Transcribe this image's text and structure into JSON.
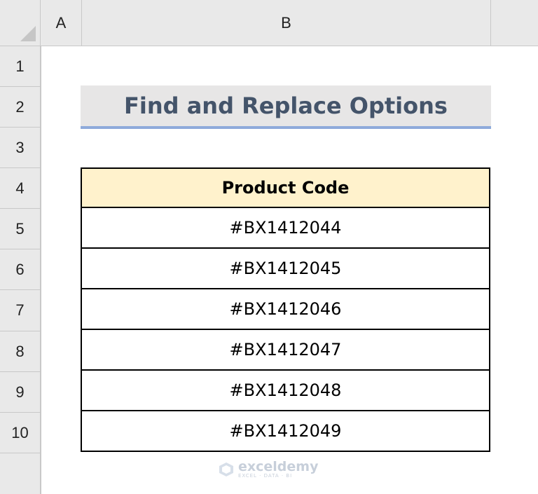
{
  "columns": [
    "A",
    "B"
  ],
  "rows": [
    "1",
    "2",
    "3",
    "4",
    "5",
    "6",
    "7",
    "8",
    "9",
    "10"
  ],
  "title": "Find and Replace Options",
  "table": {
    "header": "Product Code",
    "codes": [
      "#BX1412044",
      "#BX1412045",
      "#BX1412046",
      "#BX1412047",
      "#BX1412048",
      "#BX1412049"
    ]
  },
  "watermark": {
    "name": "exceldemy",
    "tagline": "EXCEL · DATA · BI"
  },
  "colors": {
    "header_bg": "#e9e9e9",
    "title_bg": "#e7e6e6",
    "title_text": "#44546a",
    "title_underline": "#8eaadb",
    "table_header_bg": "#fff2cc"
  }
}
